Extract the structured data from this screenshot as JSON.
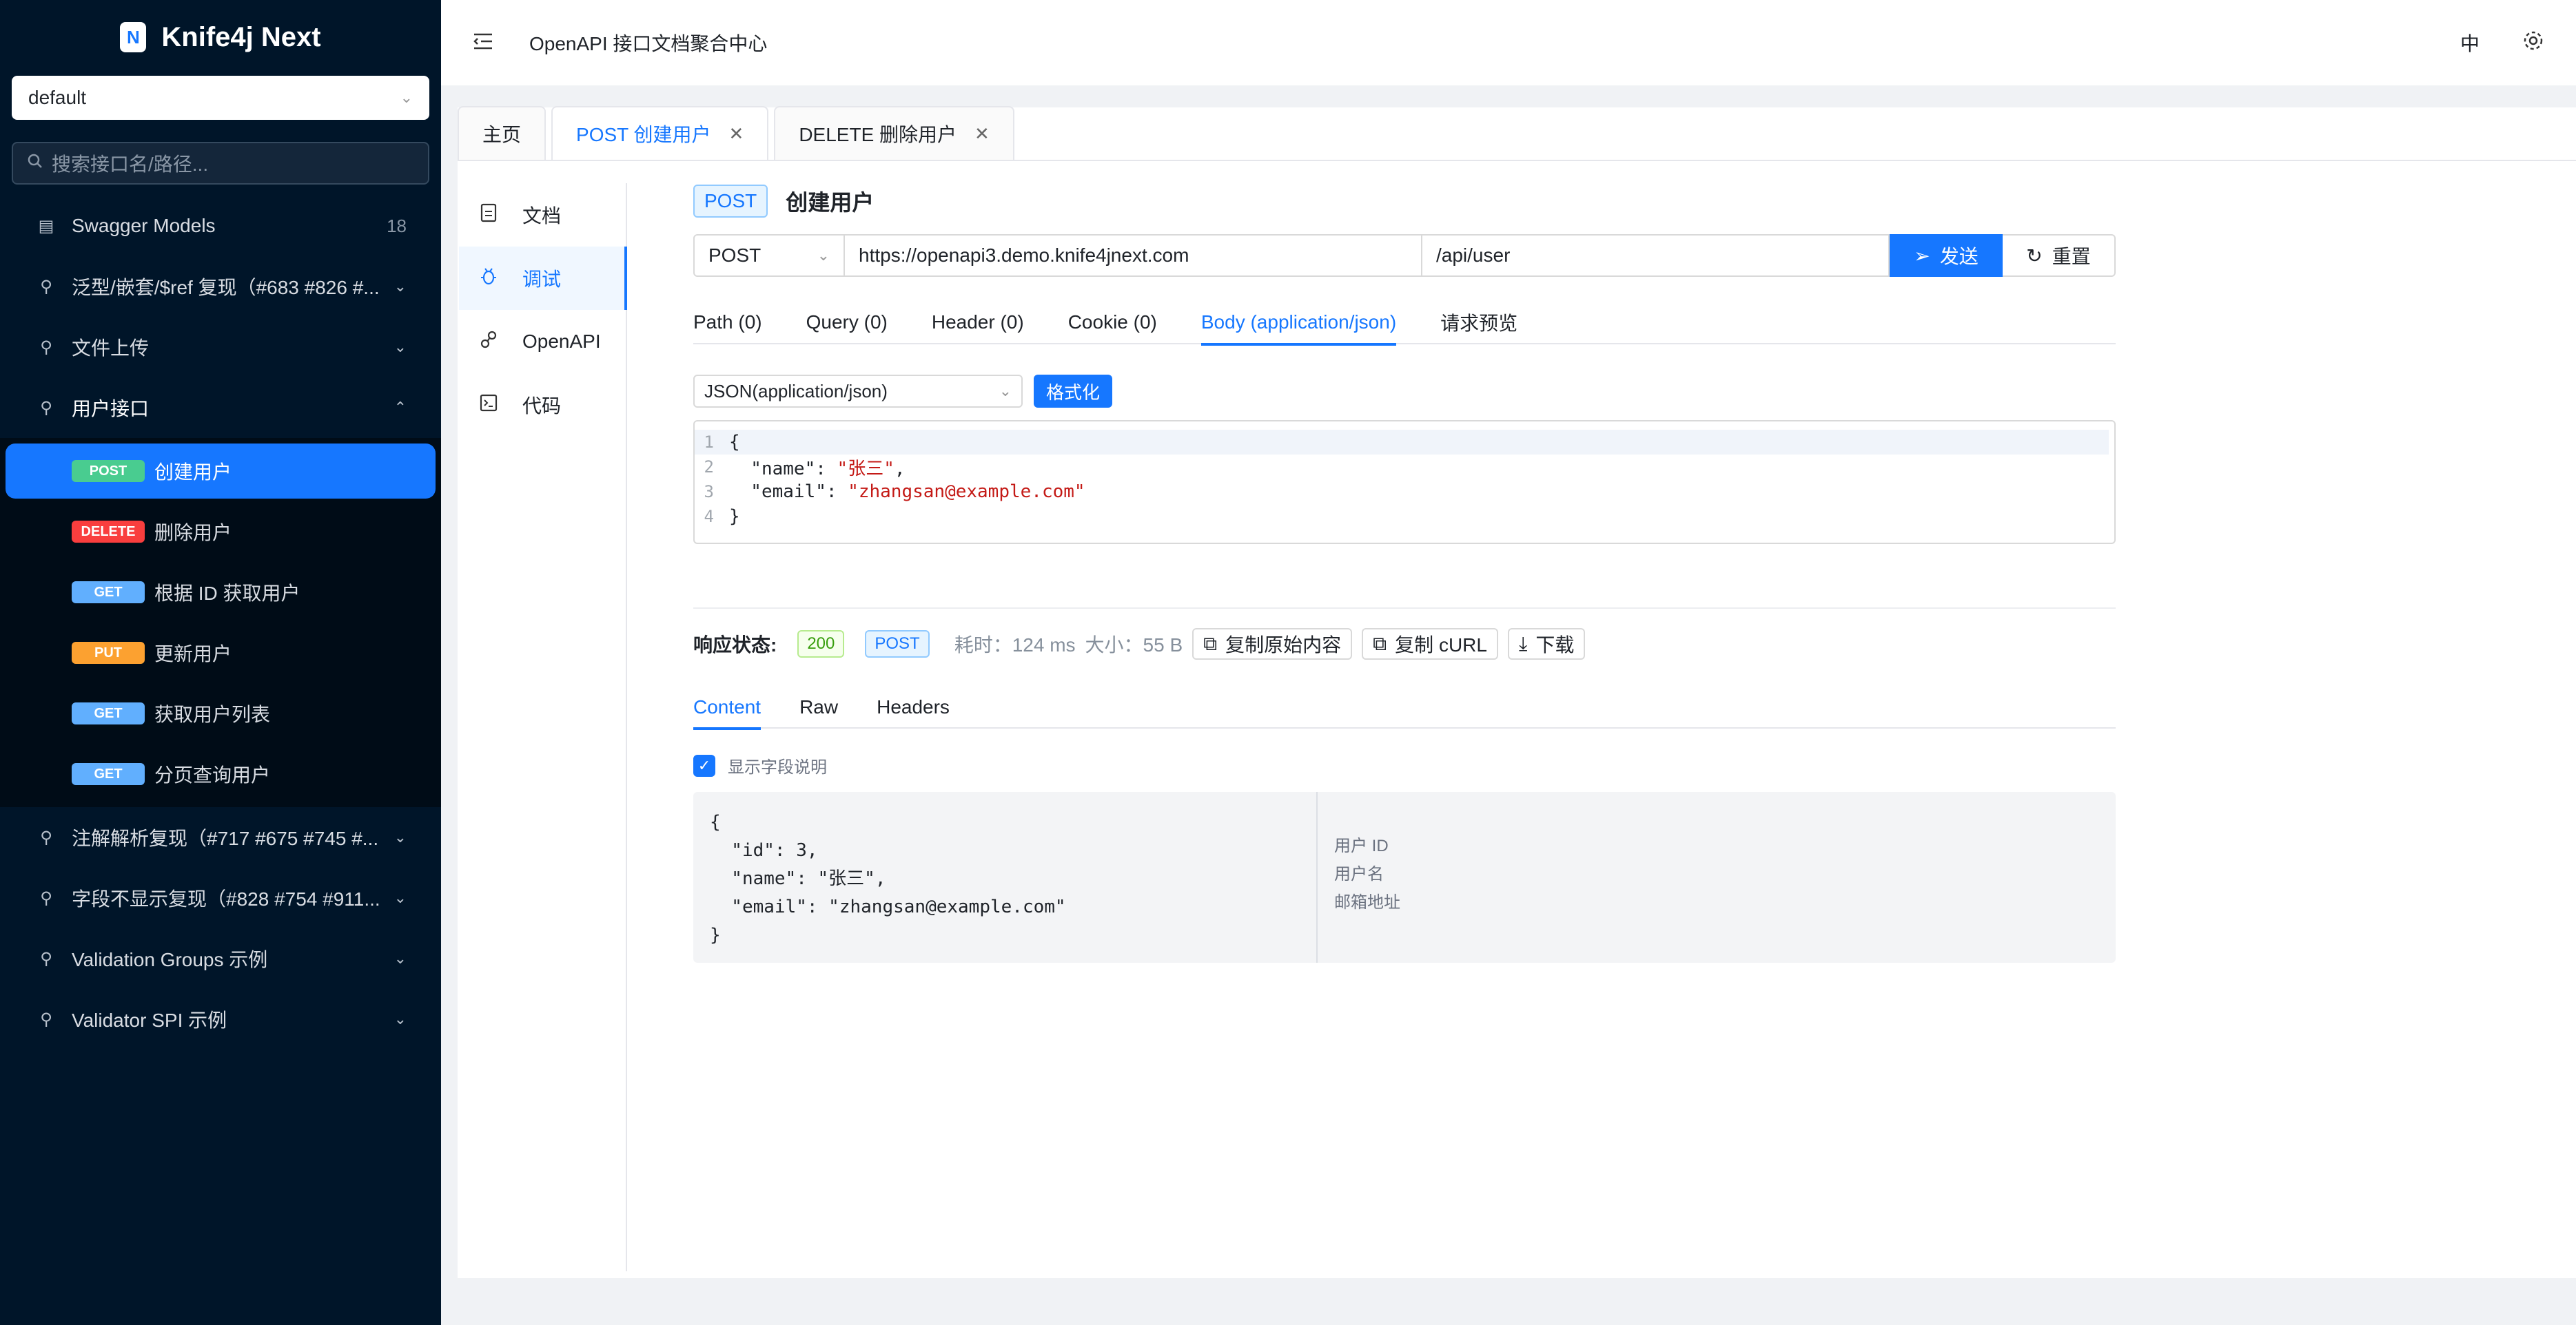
{
  "app": {
    "logo_letter": "N",
    "name": "Knife4j Next"
  },
  "sidebar": {
    "group_value": "default",
    "search_placeholder": "搜索接口名/路径...",
    "items": [
      {
        "label": "Swagger Models",
        "count": "18",
        "icon": "table-icon"
      },
      {
        "label": "泛型/嵌套/$ref 复现（#683 #826 #...",
        "icon": "api-icon"
      },
      {
        "label": "文件上传",
        "icon": "api-icon"
      },
      {
        "label": "用户接口",
        "icon": "api-icon",
        "expanded": true
      }
    ],
    "sub_items": [
      {
        "method": "POST",
        "label": "创建用户",
        "active": true
      },
      {
        "method": "DELETE",
        "label": "删除用户"
      },
      {
        "method": "GET",
        "label": "根据 ID 获取用户"
      },
      {
        "method": "PUT",
        "label": "更新用户"
      },
      {
        "method": "GET",
        "label": "获取用户列表"
      },
      {
        "method": "GET",
        "label": "分页查询用户"
      }
    ],
    "items_after": [
      {
        "label": "注解解析复现（#717 #675 #745 #..."
      },
      {
        "label": "字段不显示复现（#828 #754 #911..."
      },
      {
        "label": "Validation Groups 示例"
      },
      {
        "label": "Validator SPI 示例"
      }
    ]
  },
  "header": {
    "title": "OpenAPI 接口文档聚合中心",
    "lang": "中"
  },
  "tabs": [
    {
      "label": "主页"
    },
    {
      "label": "POST 创建用户",
      "active": true
    },
    {
      "label": "DELETE 删除用户"
    }
  ],
  "left_menu": [
    {
      "label": "文档",
      "icon": "doc-icon"
    },
    {
      "label": "调试",
      "icon": "bug-icon",
      "active": true
    },
    {
      "label": "OpenAPI",
      "icon": "api-icon"
    },
    {
      "label": "代码",
      "icon": "code-icon"
    }
  ],
  "api": {
    "method": "POST",
    "title": "创建用户",
    "select_method": "POST",
    "base_url": "https://openapi3.demo.knife4jnext.com",
    "path": "/api/user",
    "send_label": "发送",
    "reset_label": "重置"
  },
  "param_tabs": [
    "Path (0)",
    "Query (0)",
    "Header (0)",
    "Cookie (0)",
    "Body (application/json)",
    "请求预览"
  ],
  "body": {
    "content_type": "JSON(application/json)",
    "format_label": "格式化",
    "lines": [
      {
        "n": "1",
        "pre": "{",
        "str": "",
        "post": ""
      },
      {
        "n": "2",
        "pre": "  \"name\": ",
        "str": "\"张三\"",
        "post": ","
      },
      {
        "n": "3",
        "pre": "  \"email\": ",
        "str": "\"zhangsan@example.com\"",
        "post": ""
      },
      {
        "n": "4",
        "pre": "}",
        "str": "",
        "post": ""
      }
    ]
  },
  "response": {
    "status_label": "响应状态:",
    "status_code": "200",
    "method": "POST",
    "time": "耗时：124 ms",
    "size": "大小：55 B",
    "copy_raw_label": "复制原始内容",
    "copy_curl_label": "复制 cURL",
    "download_label": "下载",
    "tabs": [
      "Content",
      "Raw",
      "Headers"
    ],
    "show_desc_label": "显示字段说明",
    "code": "{\n  \"id\": 3,\n  \"name\": \"张三\",\n  \"email\": \"zhangsan@example.com\"\n}",
    "descriptions": [
      "用户 ID",
      "用户名",
      "邮箱地址"
    ]
  },
  "colors": {
    "accent": "#1677ff",
    "sidebar_bg": "#001529",
    "post": "#49cc90",
    "delete": "#f93e3e",
    "get": "#61affe",
    "put": "#fca130"
  }
}
